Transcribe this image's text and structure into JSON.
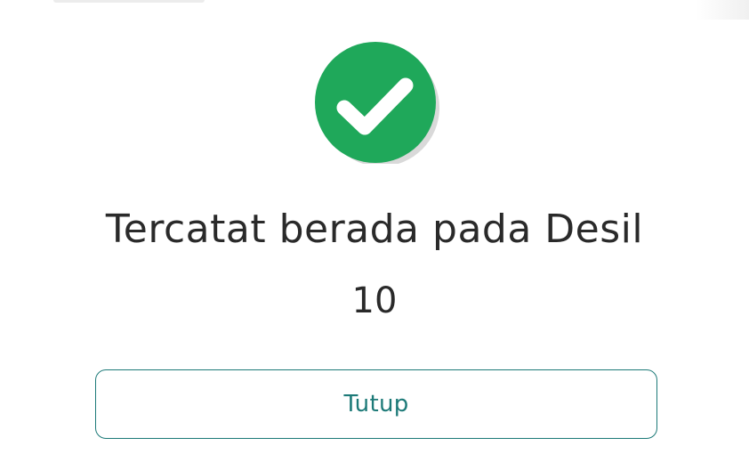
{
  "dialog": {
    "icon": "check-circle-icon",
    "title": "Tercatat berada pada Desil",
    "value": "10",
    "close_label": "Tutup"
  },
  "colors": {
    "success_green": "#1fa85a",
    "accent_teal": "#1d7a78",
    "text": "#2a2a2a"
  }
}
